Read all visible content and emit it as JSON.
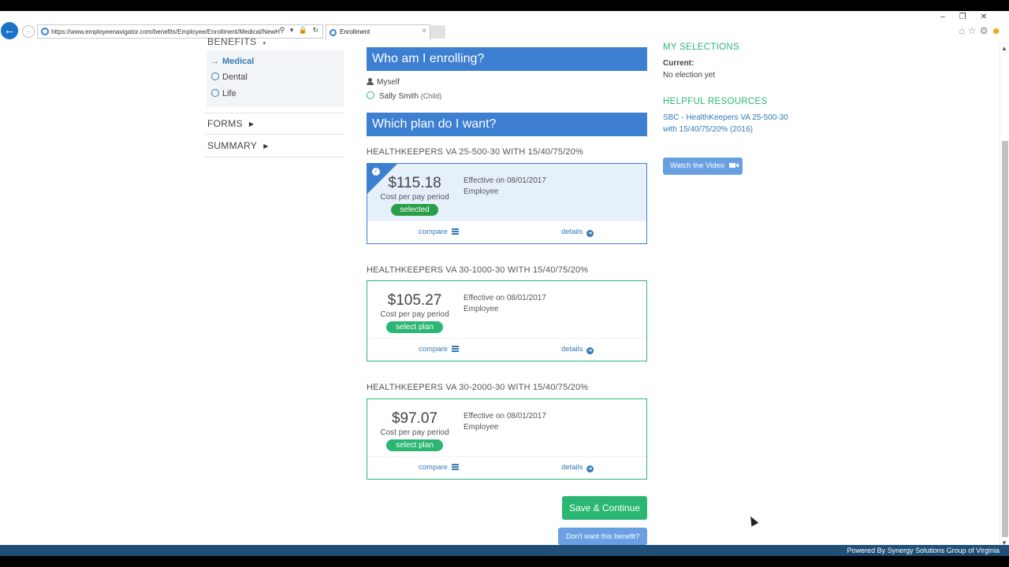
{
  "browser": {
    "url": "https://www.employeenavigator.com/benefits/Employee/Enrollment/Medical/NewH",
    "tab_title": "Enrollment",
    "tab_close": "×",
    "address_icons": "⚲ ▾ 🔒 ↻"
  },
  "sidebar": {
    "benefits_label": "BENEFITS",
    "items": [
      {
        "label": "Medical"
      },
      {
        "label": "Dental"
      },
      {
        "label": "Life"
      }
    ],
    "forms_label": "FORMS",
    "summary_label": "SUMMARY"
  },
  "who": {
    "heading": "Who am I enrolling?",
    "myself": "Myself",
    "dependent_name": "Sally Smith",
    "dependent_tag": "(Child)"
  },
  "plans_heading": "Which plan do I want?",
  "plans": [
    {
      "name": "HEALTHKEEPERS VA 25-500-30 WITH 15/40/75/20%",
      "price": "$115.18",
      "period": "Cost per pay period",
      "action": "selected",
      "effective": "Effective on 08/01/2017",
      "coverage": "Employee",
      "compare": "compare",
      "details": "details"
    },
    {
      "name": "HEALTHKEEPERS VA 30-1000-30 WITH 15/40/75/20%",
      "price": "$105.27",
      "period": "Cost per pay period",
      "action": "select plan",
      "effective": "Effective on 08/01/2017",
      "coverage": "Employee",
      "compare": "compare",
      "details": "details"
    },
    {
      "name": "HEALTHKEEPERS VA 30-2000-30 WITH 15/40/75/20%",
      "price": "$97.07",
      "period": "Cost per pay period",
      "action": "select plan",
      "effective": "Effective on 08/01/2017",
      "coverage": "Employee",
      "compare": "compare",
      "details": "details"
    }
  ],
  "actions": {
    "save": "Save & Continue",
    "decline": "Don't want this benefit?"
  },
  "selections": {
    "heading": "MY SELECTIONS",
    "current_label": "Current:",
    "current_value": "No election yet"
  },
  "resources": {
    "heading": "HELPFUL RESOURCES",
    "link": "SBC - HealthKeepers VA 25-500-30 with 15/40/75/20% (2016)",
    "video": "Watch the Video"
  },
  "footer": "Powered By Synergy Solutions Group of Virginia",
  "colors": {
    "primary_blue": "#3d7fd1",
    "accent_green": "#2bb673",
    "footer_bg": "#1f4f76"
  }
}
